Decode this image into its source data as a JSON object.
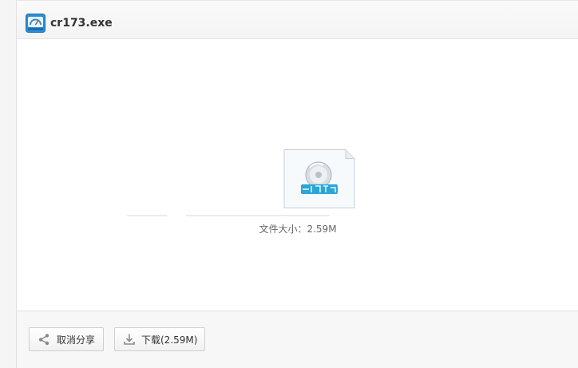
{
  "header": {
    "title": "cr173.exe",
    "icon": "app-icon"
  },
  "content": {
    "file_icon": "exe-disc-icon",
    "file_size_label": "文件大小：",
    "file_size_value": "2.59M"
  },
  "footer": {
    "cancel_share_label": "取消分享",
    "download_label": "下载(2.59M)"
  },
  "colors": {
    "accent": "#2b8fd6",
    "button_border": "#cfcfcf",
    "text": "#333333"
  }
}
